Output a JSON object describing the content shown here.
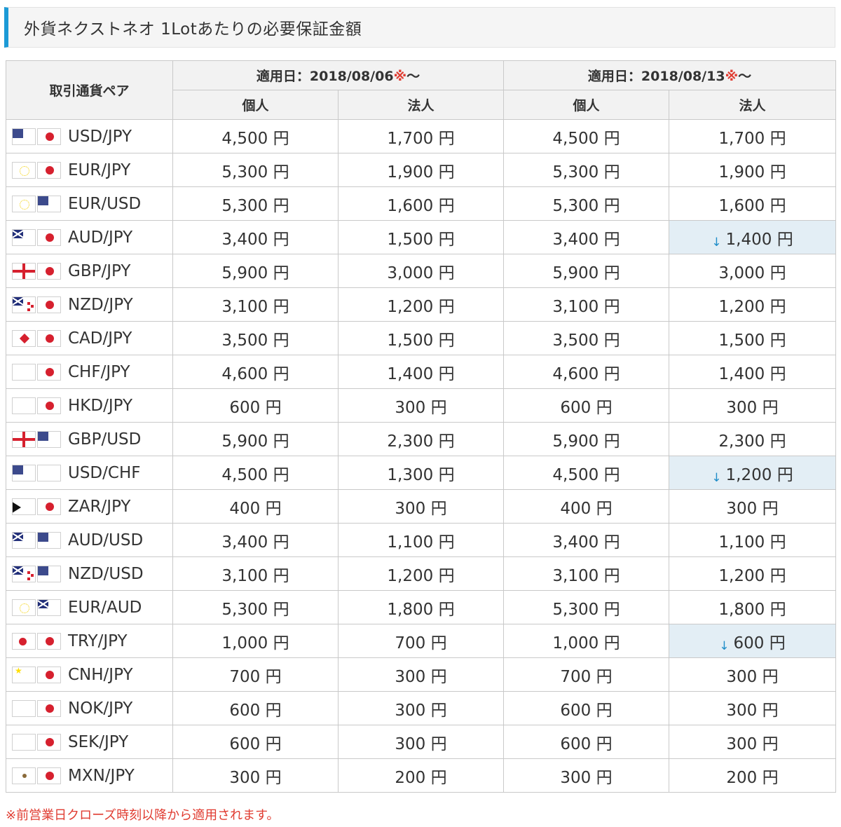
{
  "title": "外貨ネクストネオ 1Lotあたりの必要保証金額",
  "table": {
    "pair_header": "取引通貨ペア",
    "periods": [
      {
        "label": "適用日：2018/08/06",
        "mark": "※",
        "suffix": "〜"
      },
      {
        "label": "適用日：2018/08/13",
        "mark": "※",
        "suffix": "〜"
      }
    ],
    "sub_headers": [
      "個人",
      "法人",
      "個人",
      "法人"
    ],
    "rows": [
      {
        "pair": "USD/JPY",
        "flags": [
          "us-flag-icon",
          "japan-flag-icon"
        ],
        "values": [
          "4,500 円",
          "1,700 円",
          "4,500 円",
          "1,700 円"
        ],
        "changed": [
          false,
          false,
          false,
          false
        ]
      },
      {
        "pair": "EUR/JPY",
        "flags": [
          "eu-flag-icon",
          "japan-flag-icon"
        ],
        "values": [
          "5,300 円",
          "1,900 円",
          "5,300 円",
          "1,900 円"
        ],
        "changed": [
          false,
          false,
          false,
          false
        ]
      },
      {
        "pair": "EUR/USD",
        "flags": [
          "eu-flag-icon",
          "us-flag-icon"
        ],
        "values": [
          "5,300 円",
          "1,600 円",
          "5,300 円",
          "1,600 円"
        ],
        "changed": [
          false,
          false,
          false,
          false
        ]
      },
      {
        "pair": "AUD/JPY",
        "flags": [
          "australia-flag-icon",
          "japan-flag-icon"
        ],
        "values": [
          "3,400 円",
          "1,500 円",
          "3,400 円",
          "1,400 円"
        ],
        "changed": [
          false,
          false,
          false,
          true
        ]
      },
      {
        "pair": "GBP/JPY",
        "flags": [
          "uk-flag-icon",
          "japan-flag-icon"
        ],
        "values": [
          "5,900 円",
          "3,000 円",
          "5,900 円",
          "3,000 円"
        ],
        "changed": [
          false,
          false,
          false,
          false
        ]
      },
      {
        "pair": "NZD/JPY",
        "flags": [
          "new-zealand-flag-icon",
          "japan-flag-icon"
        ],
        "values": [
          "3,100 円",
          "1,200 円",
          "3,100 円",
          "1,200 円"
        ],
        "changed": [
          false,
          false,
          false,
          false
        ]
      },
      {
        "pair": "CAD/JPY",
        "flags": [
          "canada-flag-icon",
          "japan-flag-icon"
        ],
        "values": [
          "3,500 円",
          "1,500 円",
          "3,500 円",
          "1,500 円"
        ],
        "changed": [
          false,
          false,
          false,
          false
        ]
      },
      {
        "pair": "CHF/JPY",
        "flags": [
          "switzerland-flag-icon",
          "japan-flag-icon"
        ],
        "values": [
          "4,600 円",
          "1,400 円",
          "4,600 円",
          "1,400 円"
        ],
        "changed": [
          false,
          false,
          false,
          false
        ]
      },
      {
        "pair": "HKD/JPY",
        "flags": [
          "hong-kong-flag-icon",
          "japan-flag-icon"
        ],
        "values": [
          "600 円",
          "300 円",
          "600 円",
          "300 円"
        ],
        "changed": [
          false,
          false,
          false,
          false
        ]
      },
      {
        "pair": "GBP/USD",
        "flags": [
          "uk-flag-icon",
          "us-flag-icon"
        ],
        "values": [
          "5,900 円",
          "2,300 円",
          "5,900 円",
          "2,300 円"
        ],
        "changed": [
          false,
          false,
          false,
          false
        ]
      },
      {
        "pair": "USD/CHF",
        "flags": [
          "us-flag-icon",
          "switzerland-flag-icon"
        ],
        "values": [
          "4,500 円",
          "1,300 円",
          "4,500 円",
          "1,200 円"
        ],
        "changed": [
          false,
          false,
          false,
          true
        ]
      },
      {
        "pair": "ZAR/JPY",
        "flags": [
          "south-africa-flag-icon",
          "japan-flag-icon"
        ],
        "values": [
          "400 円",
          "300 円",
          "400 円",
          "300 円"
        ],
        "changed": [
          false,
          false,
          false,
          false
        ]
      },
      {
        "pair": "AUD/USD",
        "flags": [
          "australia-flag-icon",
          "us-flag-icon"
        ],
        "values": [
          "3,400 円",
          "1,100 円",
          "3,400 円",
          "1,100 円"
        ],
        "changed": [
          false,
          false,
          false,
          false
        ]
      },
      {
        "pair": "NZD/USD",
        "flags": [
          "new-zealand-flag-icon",
          "us-flag-icon"
        ],
        "values": [
          "3,100 円",
          "1,200 円",
          "3,100 円",
          "1,200 円"
        ],
        "changed": [
          false,
          false,
          false,
          false
        ]
      },
      {
        "pair": "EUR/AUD",
        "flags": [
          "eu-flag-icon",
          "australia-flag-icon"
        ],
        "values": [
          "5,300 円",
          "1,800 円",
          "5,300 円",
          "1,800 円"
        ],
        "changed": [
          false,
          false,
          false,
          false
        ]
      },
      {
        "pair": "TRY/JPY",
        "flags": [
          "turkey-flag-icon",
          "japan-flag-icon"
        ],
        "values": [
          "1,000 円",
          "700 円",
          "1,000 円",
          "600 円"
        ],
        "changed": [
          false,
          false,
          false,
          true
        ]
      },
      {
        "pair": "CNH/JPY",
        "flags": [
          "china-flag-icon",
          "japan-flag-icon"
        ],
        "values": [
          "700 円",
          "300 円",
          "700 円",
          "300 円"
        ],
        "changed": [
          false,
          false,
          false,
          false
        ]
      },
      {
        "pair": "NOK/JPY",
        "flags": [
          "norway-flag-icon",
          "japan-flag-icon"
        ],
        "values": [
          "600 円",
          "300 円",
          "600 円",
          "300 円"
        ],
        "changed": [
          false,
          false,
          false,
          false
        ]
      },
      {
        "pair": "SEK/JPY",
        "flags": [
          "sweden-flag-icon",
          "japan-flag-icon"
        ],
        "values": [
          "600 円",
          "300 円",
          "600 円",
          "300 円"
        ],
        "changed": [
          false,
          false,
          false,
          false
        ]
      },
      {
        "pair": "MXN/JPY",
        "flags": [
          "mexico-flag-icon",
          "japan-flag-icon"
        ],
        "values": [
          "300 円",
          "200 円",
          "300 円",
          "200 円"
        ],
        "changed": [
          false,
          false,
          false,
          false
        ]
      }
    ],
    "decrease_arrow_icon": "down-arrow-icon",
    "decrease_arrow_glyph": "↓",
    "highlight_color": "#e3eef5",
    "arrow_color": "#1f8dc8",
    "mark_color": "#e03c31"
  },
  "footnote": "※前営業日クローズ時刻以降から適用されます。",
  "colors": {
    "accent": "#1c9ad6",
    "header_bg": "#f2f2f2",
    "border": "#c9c9c9"
  }
}
